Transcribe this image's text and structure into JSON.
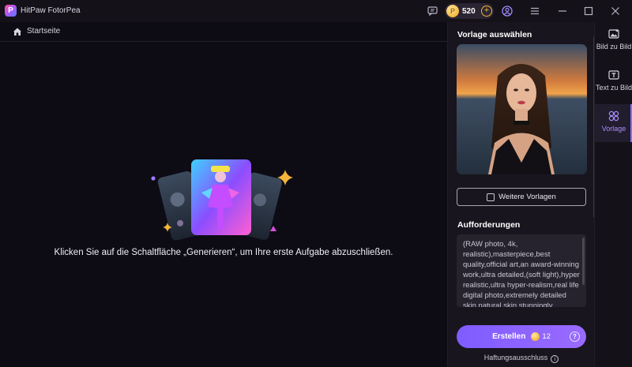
{
  "app": {
    "title": "HitPaw FotorPea",
    "logo_letter": "P",
    "credits": "520"
  },
  "titlebar_icons": [
    "feedback-icon",
    "coin-icon",
    "add-credits-icon",
    "account-icon",
    "menu-icon",
    "minimize-icon",
    "maximize-icon",
    "close-icon"
  ],
  "breadcrumb": {
    "home_label": "Startseite"
  },
  "main": {
    "hint": "Klicken Sie auf die Schaltfläche „Generieren“, um Ihre erste Aufgabe abzuschließen."
  },
  "panel": {
    "template_title": "Vorlage auswählen",
    "more_templates": "Weitere Vorlagen",
    "requirements_title": "Aufforderungen",
    "prompt": "(RAW photo, 4k,\nrealistic),masterpiece,best\nquality,official art,an award-winning\nwork,ultra detailed,(soft light),hyper\nrealistic,ultra hyper-realism,real life\ndigital photo,extremely detailed\nskin,natural skin,stunningly",
    "create_label": "Erstellen",
    "create_cost": "12",
    "disclaimer": "Haftungsausschluss"
  },
  "sidenav": {
    "items": [
      {
        "label": "Bild zu Bild",
        "icon": "image-to-image-icon",
        "active": false
      },
      {
        "label": "Text zu Bild",
        "icon": "text-to-image-icon",
        "active": false
      },
      {
        "label": "Vorlage",
        "icon": "template-icon",
        "active": true
      }
    ]
  },
  "colors": {
    "accent": "#8a6cff",
    "background": "#0d0b14",
    "panel": "#18151e",
    "coin": "#f3b53a"
  }
}
